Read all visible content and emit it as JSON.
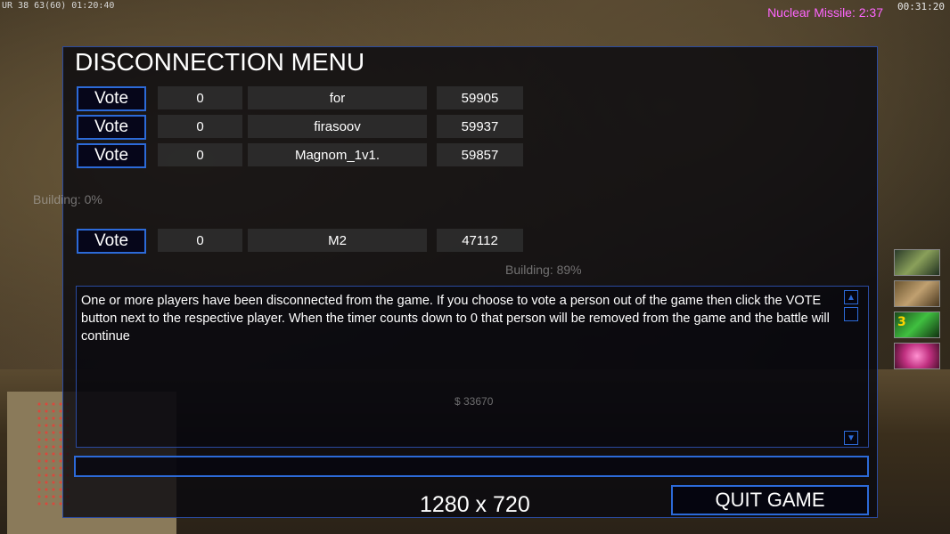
{
  "hud": {
    "top_left": "UR 38 63(60) 01:20:40",
    "clock": "00:31:20",
    "nuke_timer": "Nuclear Missile: 2:37",
    "side_icon_count": "3"
  },
  "dialog": {
    "title": "DISCONNECTION MENU",
    "vote_label": "Vote",
    "players": [
      {
        "votes": "0",
        "name": "for",
        "ping": "59905"
      },
      {
        "votes": "0",
        "name": "firasoov",
        "ping": "59937"
      },
      {
        "votes": "0",
        "name": "Magnom_1v1.",
        "ping": "59857"
      },
      {
        "votes": "0",
        "name": "M2",
        "ping": "47112"
      }
    ],
    "message": "One or more players have been disconnected from the game. If you choose to vote a person out of the game then click the VOTE button next to the respective player. When the timer counts down to 0 that person will be removed from the game and the battle will continue",
    "chat_value": "",
    "resolution": "1280 x 720",
    "quit_label": "QUIT GAME"
  },
  "background_text": {
    "building_a": "Building: 0%",
    "building_b": "Building: 89%",
    "money": "$ 33670"
  },
  "colors": {
    "accent": "#2c6ad8",
    "nuke": "#ff66ff"
  }
}
